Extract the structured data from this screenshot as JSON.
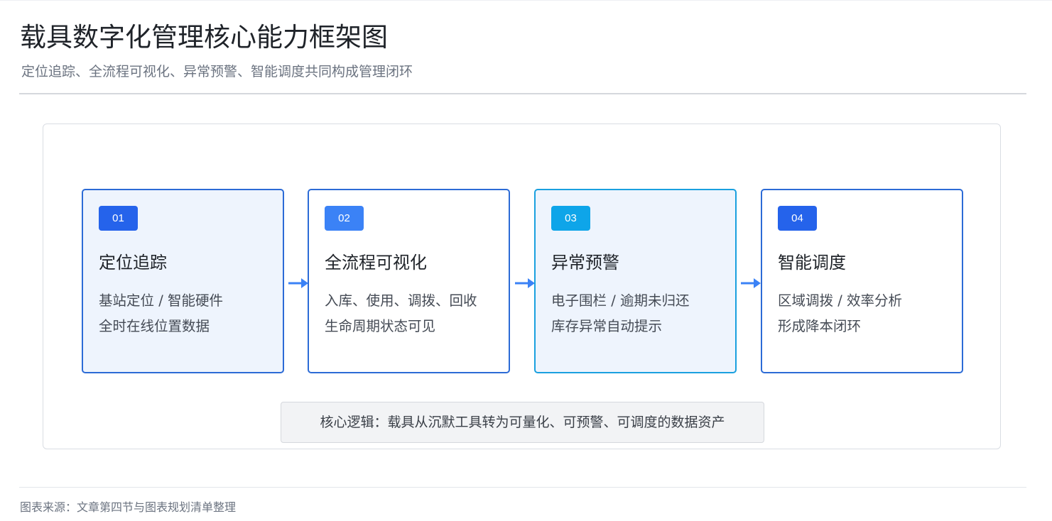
{
  "header": {
    "title": "载具数字化管理核心能力框架图",
    "subtitle": "定位追踪、全流程可视化、异常预警、智能调度共同构成管理闭环"
  },
  "steps": [
    {
      "number": "01",
      "title": "定位追踪",
      "line1": "基站定位 / 智能硬件",
      "line2": "全时在线位置数据",
      "badge_color": "#2563eb",
      "filled": true
    },
    {
      "number": "02",
      "title": "全流程可视化",
      "line1": "入库、使用、调拨、回收",
      "line2": "生命周期状态可见",
      "badge_color": "#3b82f6",
      "filled": false
    },
    {
      "number": "03",
      "title": "异常预警",
      "line1": "电子围栏 / 逾期未归还",
      "line2": "库存异常自动提示",
      "badge_color": "#0ea5e9",
      "filled": true
    },
    {
      "number": "04",
      "title": "智能调度",
      "line1": "区域调拨 / 效率分析",
      "line2": "形成降本闭环",
      "badge_color": "#2563eb",
      "filled": false
    }
  ],
  "note": {
    "text": "核心逻辑：载具从沉默工具转为可量化、可预警、可调度的数据资产"
  },
  "footer": {
    "source": "图表来源：文章第四节与图表规划清单整理"
  },
  "colors": {
    "card_border": "#2c6bd6",
    "card_border_teal": "#1aa0df",
    "card_fill": "#eef4fd",
    "arrow": "#3b82f6"
  }
}
